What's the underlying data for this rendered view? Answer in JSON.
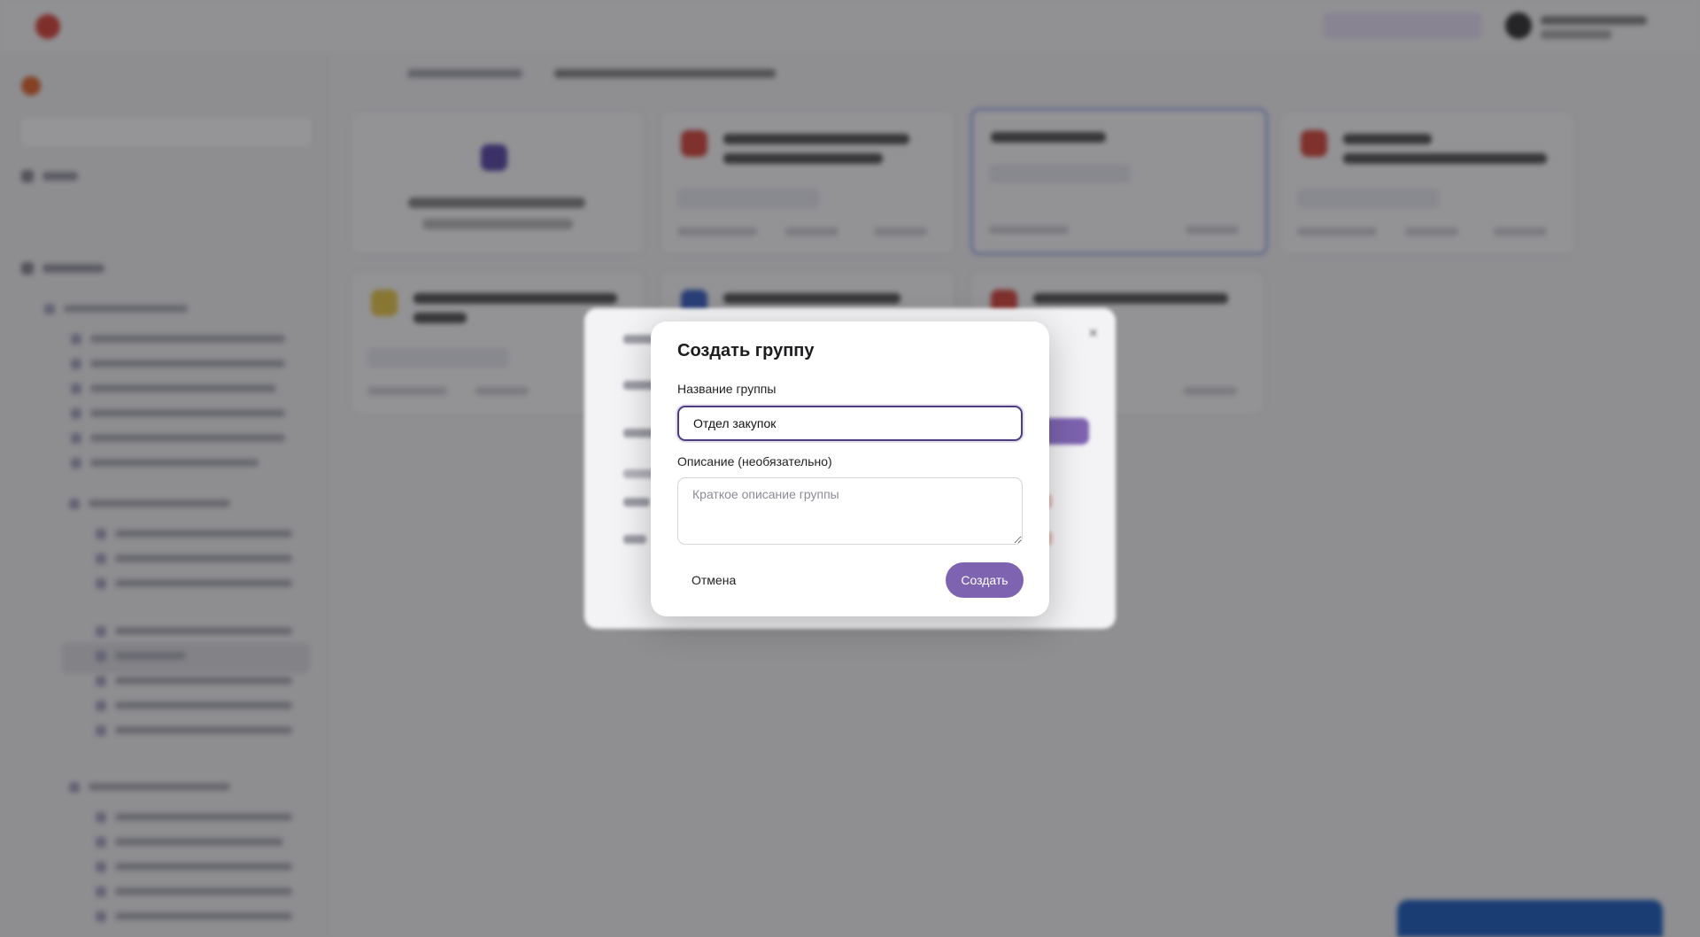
{
  "dialog": {
    "title": "Создать группу",
    "name_label": "Название группы",
    "name_value": "Отдел закупок",
    "description_label": "Описание (необязательно)",
    "description_placeholder": "Краткое описание группы",
    "cancel_label": "Отмена",
    "create_label": "Создать"
  },
  "background_dialog": {
    "close_icon": "×"
  },
  "colors": {
    "accent": "#7d63b0",
    "input_focus_border": "#4e3c80",
    "brand_red": "#d8453b"
  }
}
